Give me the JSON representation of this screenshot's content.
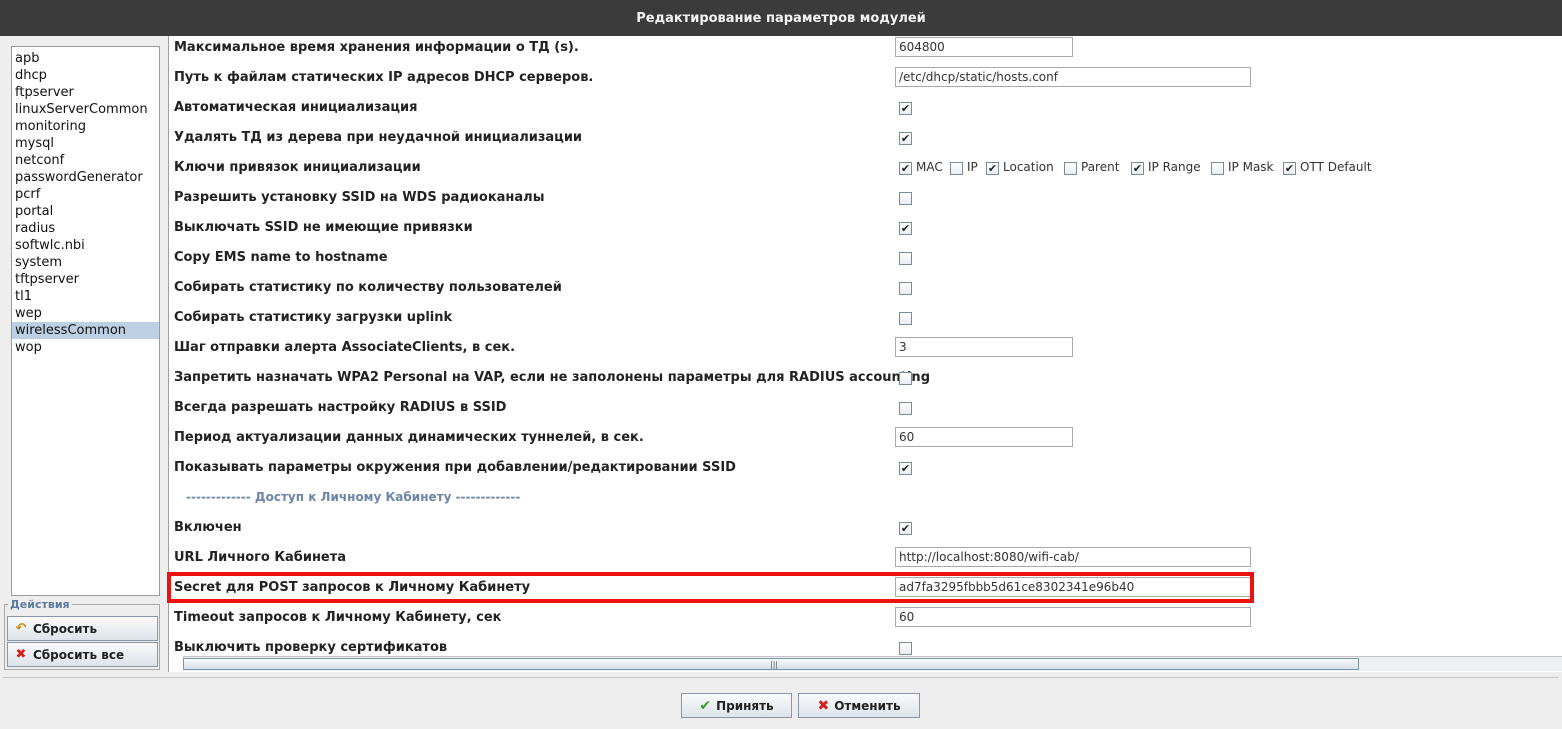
{
  "window": {
    "title": "Редактирование параметров модулей"
  },
  "modules": [
    {
      "label": "apb"
    },
    {
      "label": "dhcp"
    },
    {
      "label": "ftpserver"
    },
    {
      "label": "linuxServerCommon"
    },
    {
      "label": "monitoring"
    },
    {
      "label": "mysql"
    },
    {
      "label": "netconf"
    },
    {
      "label": "passwordGenerator"
    },
    {
      "label": "pcrf"
    },
    {
      "label": "portal"
    },
    {
      "label": "radius"
    },
    {
      "label": "softwlc.nbi"
    },
    {
      "label": "system"
    },
    {
      "label": "tftpserver"
    },
    {
      "label": "tl1"
    },
    {
      "label": "wep"
    },
    {
      "label": "wirelessCommon",
      "selected": true
    },
    {
      "label": "wop"
    }
  ],
  "actions": {
    "legend": "Действия",
    "reset": "Сбросить",
    "reset_all": "Сбросить все"
  },
  "params": [
    {
      "label": "Максимальное время хранения информации о ТД (s).",
      "type": "text",
      "value": "604800",
      "width": "short"
    },
    {
      "label": "Путь к файлам статических IP адресов DHCP серверов.",
      "type": "text",
      "value": "/etc/dhcp/static/hosts.conf",
      "width": "long"
    },
    {
      "label": "Автоматическая инициализация",
      "type": "check",
      "checked": true
    },
    {
      "label": "Удалять ТД из дерева при неудачной инициализации",
      "type": "check",
      "checked": true
    },
    {
      "label": "Ключи привязок инициализации",
      "type": "multi",
      "options": [
        {
          "label": "MAC",
          "checked": true
        },
        {
          "label": "IP",
          "checked": false
        },
        {
          "label": "Location",
          "checked": true
        },
        {
          "label": "Parent",
          "checked": false
        },
        {
          "label": "IP Range",
          "checked": true
        },
        {
          "label": "IP Mask",
          "checked": false
        },
        {
          "label": "OTT Default",
          "checked": true
        }
      ]
    },
    {
      "label": "Разрешить установку SSID на WDS радиоканалы",
      "type": "check",
      "checked": false
    },
    {
      "label": "Выключать SSID не имеющие привязки",
      "type": "check",
      "checked": true
    },
    {
      "label": "Copy EMS name to hostname",
      "type": "check",
      "checked": false
    },
    {
      "label": "Собирать статистику по количеству пользователей",
      "type": "check",
      "checked": false
    },
    {
      "label": "Собирать статистику загрузки uplink",
      "type": "check",
      "checked": false
    },
    {
      "label": "Шаг отправки алерта AssociateClients, в сек.",
      "type": "text",
      "value": "3",
      "width": "short"
    },
    {
      "label": "Запретить назначать WPA2 Personal на VAP, если не заполонены параметры для RADIUS accounting",
      "type": "check",
      "checked": false
    },
    {
      "label": "Всегда разрешать настройку RADIUS в SSID",
      "type": "check",
      "checked": false
    },
    {
      "label": "Период актуализации данных динамических туннелей, в сек.",
      "type": "text",
      "value": "60",
      "width": "short"
    },
    {
      "label": "Показывать параметры окружения при добавлении/редактировании SSID",
      "type": "check",
      "checked": true
    },
    {
      "label": "------------- Доступ к Личному Кабинету -------------",
      "type": "section"
    },
    {
      "label": "Включен",
      "type": "check",
      "checked": true
    },
    {
      "label": "URL Личного Кабинета",
      "type": "text",
      "value": "http://localhost:8080/wifi-cab/",
      "width": "long"
    },
    {
      "label": "Secret для POST запросов к Личному Кабинету",
      "type": "text",
      "value": "ad7fa3295fbbb5d61ce8302341e96b40",
      "width": "long"
    },
    {
      "label": "Timeout запросов к Личному Кабинету, сек",
      "type": "text",
      "value": "60",
      "width": "long"
    },
    {
      "label": "Выключить проверку сертификатов",
      "type": "check",
      "checked": false
    }
  ],
  "check_mark": "✔",
  "footer": {
    "accept": "Принять",
    "cancel": "Отменить"
  },
  "colors": {
    "highlight": "#ee1111",
    "selection": "#bcd0e4",
    "section": "#6d86a8"
  }
}
